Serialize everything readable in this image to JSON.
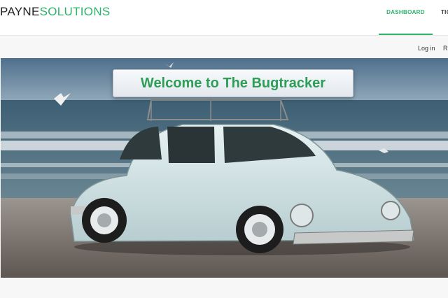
{
  "brand": {
    "part1": "PAYNE",
    "part2": "SOLUTIONS"
  },
  "nav": {
    "dashboard": "DASHBOARD",
    "next": "TIC"
  },
  "subnav": {
    "login": "Log in",
    "register": "R"
  },
  "hero": {
    "welcome": "Welcome to The Bugtracker"
  }
}
